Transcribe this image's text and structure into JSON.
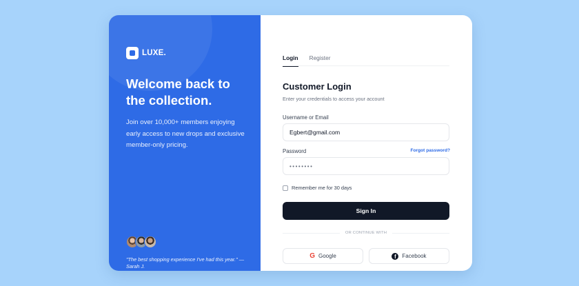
{
  "brand": {
    "name": "LUXE."
  },
  "hero": {
    "title": "Welcome back to the collection.",
    "description": "Join over 10,000+ members enjoying early access to new drops and exclusive member-only pricing.",
    "quote": "\"The best shopping experience I've had this year.\" — Sarah J."
  },
  "tabs": [
    {
      "label": "Login",
      "active": true
    },
    {
      "label": "Register",
      "active": false
    }
  ],
  "form": {
    "title": "Customer Login",
    "subtitle": "Enter your credentials to access your account",
    "username_label": "Username or Email",
    "username_value": "Egbert@gmail.com",
    "password_label": "Password",
    "password_value": "••••••••",
    "forgot_label": "Forgot password?",
    "remember_label": "Remember me for 30 days",
    "submit_label": "Sign In",
    "divider_text": "OR CONTINUE WITH",
    "google_label": "Google",
    "facebook_label": "Facebook"
  },
  "icons": {
    "brand": "luxe-logo-icon",
    "google": "google-icon",
    "facebook": "facebook-icon"
  },
  "colors": {
    "background": "#a7d3fb",
    "brand_blue": "#2e6be6",
    "primary_button": "#111827",
    "link": "#2e6be6"
  }
}
